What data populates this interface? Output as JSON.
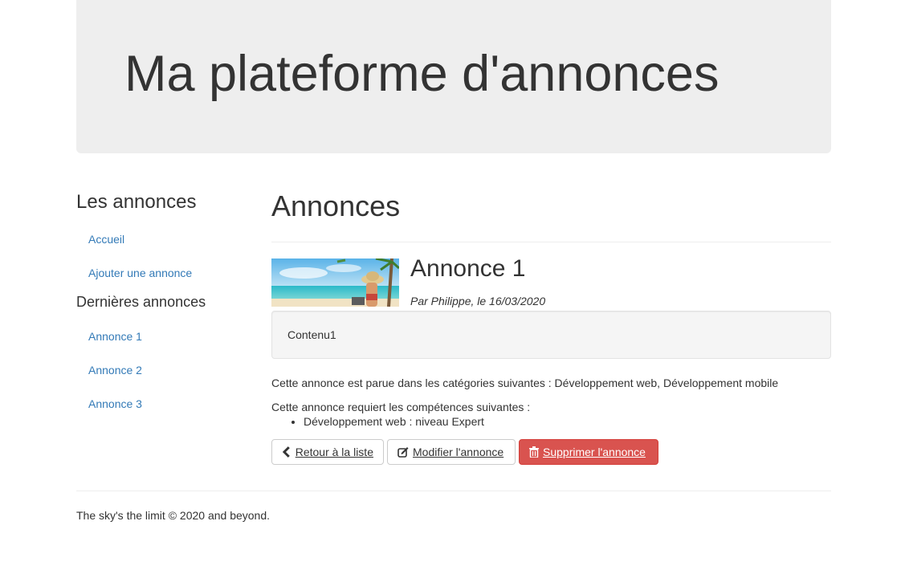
{
  "header": {
    "title": "Ma plateforme d'annonces"
  },
  "sidebar": {
    "section1_title": "Les annonces",
    "nav": [
      {
        "label": "Accueil"
      },
      {
        "label": "Ajouter une annonce"
      }
    ],
    "section2_title": "Dernières annonces",
    "latest": [
      {
        "label": "Annonce 1"
      },
      {
        "label": "Annonce 2"
      },
      {
        "label": "Annonce 3"
      }
    ]
  },
  "main": {
    "page_title": "Annonces",
    "advert": {
      "title": "Annonce 1",
      "meta": "Par Philippe, le 16/03/2020",
      "content": "Contenu1",
      "categories_text": "Cette annonce est parue dans les catégories suivantes : Développement web, Développement mobile",
      "skills_intro": "Cette annonce requiert les compétences suivantes :",
      "skills": [
        "Développement web : niveau Expert"
      ]
    },
    "buttons": {
      "back": "Retour à la liste",
      "edit": "Modifier l'annonce",
      "delete": "Supprimer l'annonce"
    }
  },
  "footer": {
    "text": "The sky's the limit © 2020 and beyond."
  },
  "colors": {
    "link": "#337ab7",
    "danger": "#d9534f",
    "jumbotron": "#eeeeee"
  }
}
